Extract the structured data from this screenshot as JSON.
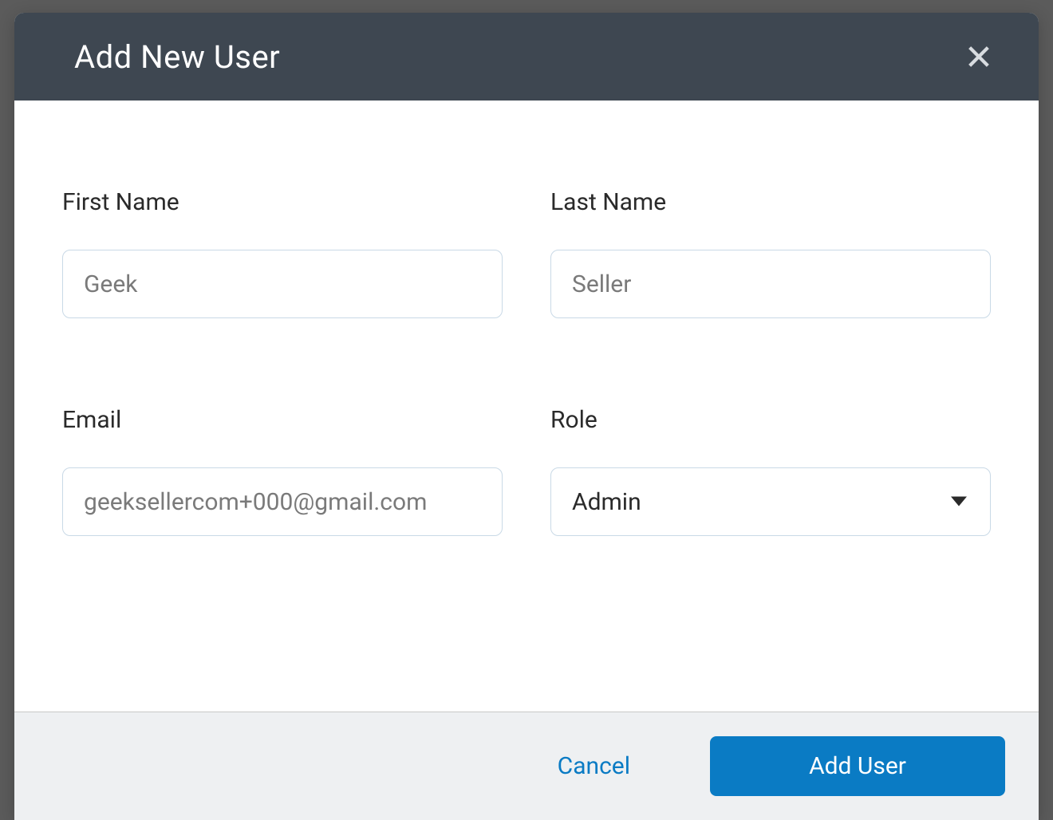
{
  "modal": {
    "title": "Add New User",
    "fields": {
      "first_name": {
        "label": "First Name",
        "value": "Geek"
      },
      "last_name": {
        "label": "Last Name",
        "value": "Seller"
      },
      "email": {
        "label": "Email",
        "value": "geeksellercom+000@gmail.com"
      },
      "role": {
        "label": "Role",
        "selected": "Admin"
      }
    },
    "actions": {
      "cancel": "Cancel",
      "submit": "Add User"
    }
  }
}
